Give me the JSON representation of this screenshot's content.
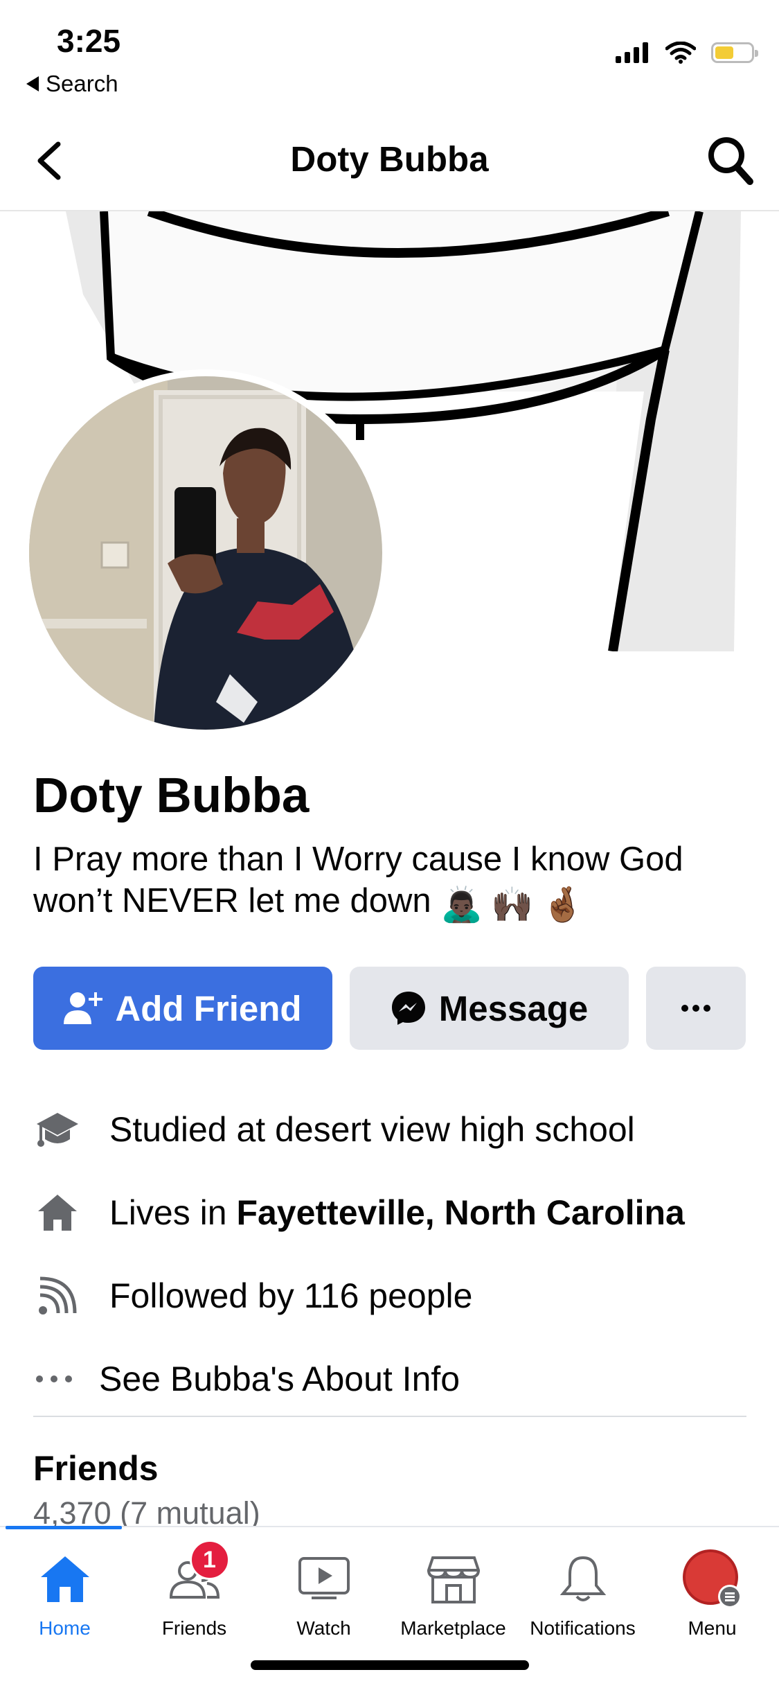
{
  "status_bar": {
    "time": "3:25",
    "back_app_label": "Search"
  },
  "nav": {
    "title": "Doty Bubba"
  },
  "profile": {
    "name": "Doty Bubba",
    "bio": "I Pray more than I Worry cause I know God won’t NEVER let me down",
    "bio_emojis": [
      "🙇🏿‍♂️",
      "🙌🏿",
      "🤞🏾"
    ]
  },
  "actions": {
    "add_friend": "Add Friend",
    "message": "Message",
    "more": "···"
  },
  "details": {
    "studied": "Studied at desert view high school",
    "lives_prefix": "Lives in ",
    "lives_location": "Fayetteville, North Carolina",
    "followed": "Followed by 116 people",
    "about": "See Bubba's About Info"
  },
  "friends": {
    "title": "Friends",
    "count": "4,370 (7 mutual)"
  },
  "tabs": [
    {
      "label": "Home",
      "icon": "home-icon",
      "active": true
    },
    {
      "label": "Friends",
      "icon": "friends-icon",
      "badge": "1"
    },
    {
      "label": "Watch",
      "icon": "watch-icon"
    },
    {
      "label": "Marketplace",
      "icon": "marketplace-icon"
    },
    {
      "label": "Notifications",
      "icon": "bell-icon"
    },
    {
      "label": "Menu",
      "icon": "menu-avatar-icon"
    }
  ],
  "colors": {
    "primary": "#3b6fe0",
    "accent": "#1877f2",
    "secondary_button": "#e4e6eb",
    "badge": "#e41e3f"
  }
}
